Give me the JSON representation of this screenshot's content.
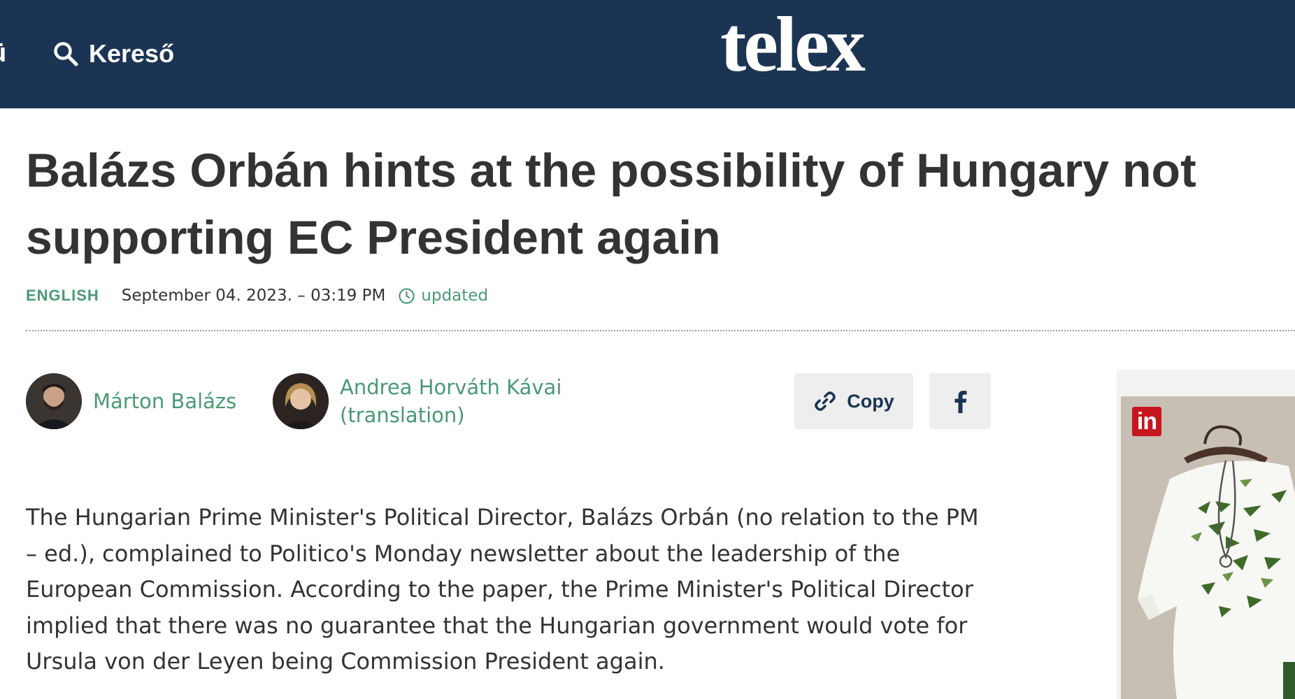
{
  "header": {
    "menu_fragment": "ü",
    "search_label": "Kereső",
    "logo": "telex"
  },
  "article": {
    "headline": "Balázs Orbán hints at the possibility of Hungary not supporting EC President again",
    "category": "English",
    "date": "September 04. 2023. – 03:19 PM",
    "updated_label": "updated",
    "authors": [
      {
        "name": "Márton Balázs"
      },
      {
        "name": "Andrea Horváth Kávai (translation)"
      }
    ],
    "share": {
      "copy_label": "Copy"
    },
    "lead": "The Hungarian Prime Minister's Political Director, Balázs Orbán (no relation to the PM – ed.), complained to Politico's Monday newsletter about the leadership of the European Commission. According to the paper, the Prime Minister's Political Director implied that there was no guarantee that the Hungarian government would vote for Ursula von der Leyen being Commission President again."
  },
  "ad": {
    "badge": "in"
  },
  "colors": {
    "header_bg": "#1b3453",
    "accent_green": "#4a9a74",
    "text": "#333333",
    "button_bg": "#eeeeee"
  },
  "icons": {
    "search": "search-icon",
    "clock": "clock-icon",
    "link": "link-icon",
    "facebook": "facebook-icon"
  }
}
